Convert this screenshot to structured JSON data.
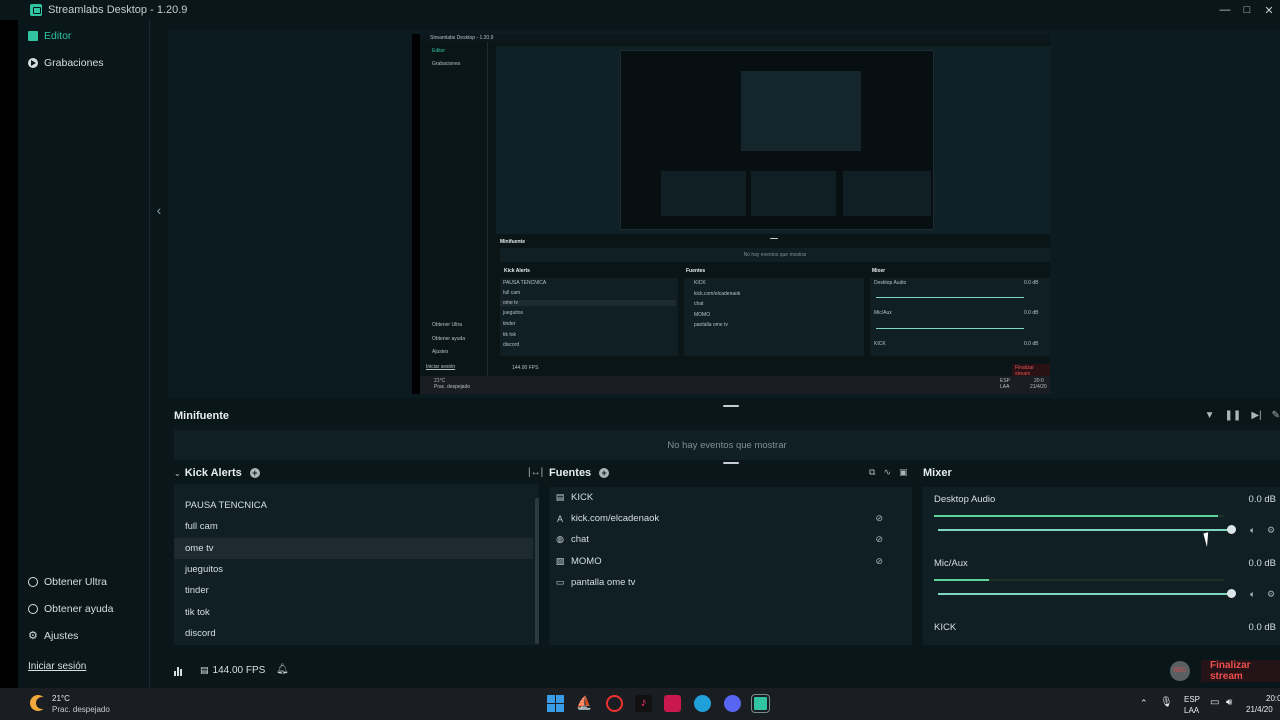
{
  "window": {
    "title": "Streamlabs Desktop - 1.20.9"
  },
  "sidebar": {
    "items": [
      {
        "label": "Editor"
      },
      {
        "label": "Grabaciones"
      }
    ],
    "bottom": [
      {
        "label": "Obtener Ultra"
      },
      {
        "label": "Obtener ayuda"
      },
      {
        "label": "Ajustes"
      }
    ],
    "login": "Iniciar sesión"
  },
  "minifeed": {
    "title": "Minifuente",
    "empty": "No hay eventos que mostrar"
  },
  "scenes": {
    "title": "Kick Alerts",
    "items": [
      "PAUSA TENCNICA",
      "full cam",
      "ome tv",
      "jueguitos",
      "tinder",
      "tik tok",
      "discord"
    ],
    "selected": "ome tv"
  },
  "sources": {
    "title": "Fuentes",
    "items": [
      {
        "label": "KICK",
        "icon": "file-icon"
      },
      {
        "label": "kick.com/elcadenaok",
        "icon": "text-icon"
      },
      {
        "label": "chat",
        "icon": "globe-icon"
      },
      {
        "label": "MOMO",
        "icon": "image-icon"
      },
      {
        "label": "pantalla ome tv",
        "icon": "monitor-icon"
      }
    ]
  },
  "mixer": {
    "title": "Mixer",
    "channels": [
      {
        "name": "Desktop Audio",
        "db": "0.0 dB",
        "meter_level": 0.98,
        "volume": 1.0
      },
      {
        "name": "Mic/Aux",
        "db": "0.0 dB",
        "meter_level": 0.19,
        "volume": 1.0
      },
      {
        "name": "KICK",
        "db": "0.0 dB"
      }
    ]
  },
  "footer": {
    "fps": "144.00 FPS",
    "rec": "REC",
    "stop": "Finalizar stream"
  },
  "nested": {
    "title": "Streamlabs Desktop - 1.20.9",
    "sidebar": [
      "Editor",
      "Grabaciones",
      "Obtener Ultra",
      "Obtener ayuda",
      "Ajustes",
      "Iniciar sesión"
    ],
    "minifeed_title": "Minifuente",
    "minifeed_empty": "No hay eventos que mostrar",
    "scenes_title": "Kick Alerts",
    "scenes": [
      "PAUSA TENCNICA",
      "full cam",
      "ome tv",
      "jueguitos",
      "tinder",
      "tik tok",
      "discord"
    ],
    "sources_title": "Fuentes",
    "sources": [
      "KICK",
      "kick.com/elcadenaok",
      "chat",
      "MOMO",
      "pantalla ome tv"
    ],
    "mixer_title": "Mixer",
    "mixer": [
      {
        "name": "Desktop Audio",
        "db": "0.0 dB"
      },
      {
        "name": "Mic/Aux",
        "db": "0.0 dB"
      },
      {
        "name": "KICK",
        "db": "0.0 dB"
      }
    ],
    "fps": "144.00 FPS",
    "stop": "Finalizar stream",
    "temp": "21°C",
    "weather": "Prac. despejado",
    "lang": "ESP",
    "kbd": "LAA",
    "time": "20:0",
    "date": "21/4/20"
  },
  "taskbar": {
    "temp": "21°C",
    "weather": "Prac. despejado",
    "lang": "ESP",
    "kbd": "LAA",
    "time": "20:0",
    "date": "21/4/20"
  }
}
